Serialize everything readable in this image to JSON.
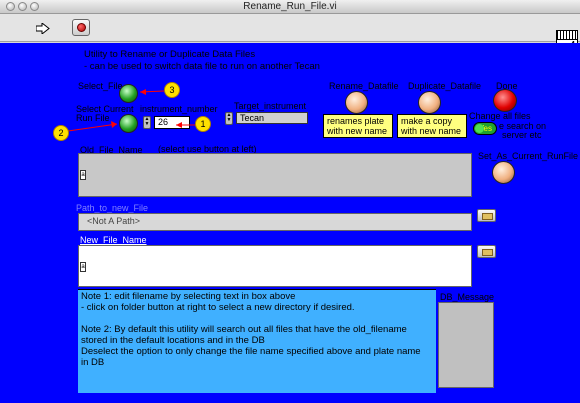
{
  "window": {
    "title": "Rename_Run_File.vi"
  },
  "toolbar": {
    "run_icon": "run-arrow-icon",
    "abort_icon": "abort-stop-icon",
    "vi_icon_number": "4"
  },
  "description": {
    "line1": "Utility to Rename or Duplicate Data Files",
    "line2": "- can be used to switch data file to run on another Tecan"
  },
  "controls": {
    "select_file_label": "Select_File",
    "select_current_label1": "Select Current",
    "select_current_label2": "Run File",
    "instrument_number_label": "instrument_number",
    "instrument_number_value": "26",
    "target_instrument_label": "Target_instrument",
    "target_instrument_value": "Tecan",
    "rename_label": "Rename_Datafile",
    "duplicate_label": "Duplicate_Datafile",
    "done_label": "Done",
    "change_all_label": "Change all files",
    "toggle_text": "Yes",
    "change_all_note1": "e search on",
    "change_all_note2": "server etc",
    "rename_note": [
      "renames plate",
      "with new name"
    ],
    "duplicate_note": [
      "make a copy",
      "with new name"
    ],
    "old_file_label": "Old_File_Name",
    "old_file_hint": "(select use button at left)",
    "set_current_label": "Set_As_Current_RunFile",
    "path_label": "Path_to_new_File",
    "path_value": "<Not A Path>",
    "new_file_label": "New_File_Name",
    "db_message_label": "DB_Message"
  },
  "notes": {
    "n1a": "Note 1: edit filename by selecting text in box above",
    "n1b": "- click on folder button at right to select a new directory if desired.",
    "n2a": "Note 2:  By default this utility will search out all files that have the old_filename",
    "n2b": "stored in the default locations and in the DB",
    "n2c": "Deselect the option to only change the file name specified above and plate name",
    "n2d": "in DB"
  },
  "badges": [
    "1",
    "2",
    "3"
  ],
  "colors": {
    "panel": "#0000ff",
    "notes_area": "#40b0ff",
    "note_yellow": "#ffff80",
    "badge": "#ffe000",
    "arrow": "#ff0000"
  }
}
